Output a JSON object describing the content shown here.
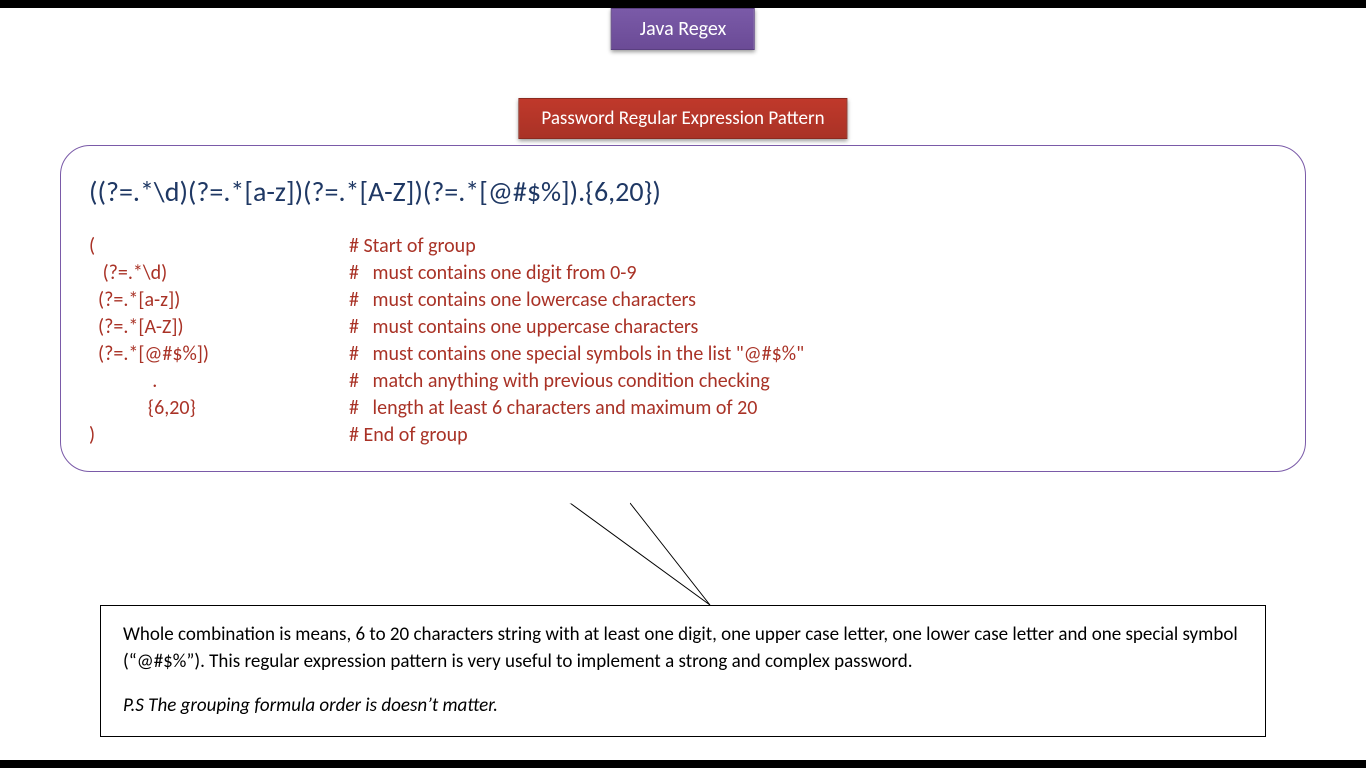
{
  "header": {
    "badge_purple": "Java Regex",
    "badge_red": "Password Regular Expression Pattern"
  },
  "regex": "((?=.*\\d)(?=.*[a-z])(?=.*[A-Z])(?=.*[@#$%]).{6,20})",
  "explanations": [
    {
      "pattern": "(",
      "desc": "# Start of group"
    },
    {
      "pattern": "   (?=.*\\d)",
      "desc": "#   must contains one digit from 0-9"
    },
    {
      "pattern": "  (?=.*[a-z])",
      "desc": "#   must contains one lowercase characters"
    },
    {
      "pattern": "  (?=.*[A-Z])",
      "desc": "#   must contains one uppercase characters"
    },
    {
      "pattern": "  (?=.*[@#$%])",
      "desc": "#   must contains one special symbols in the list \"@#$%\""
    },
    {
      "pattern": "              .",
      "desc": "#   match anything with previous condition checking"
    },
    {
      "pattern": "             {6,20}",
      "desc": "#   length at least 6 characters and maximum of 20"
    },
    {
      "pattern": ")",
      "desc": "# End of group"
    }
  ],
  "note": {
    "body": "Whole combination is means, 6 to 20 characters string with at least one digit, one upper case letter, one lower case letter and one special symbol (“@#$%”). This regular expression pattern is very useful to implement a strong and complex password.",
    "ps": "P.S The grouping formula order is doesn’t matter."
  }
}
